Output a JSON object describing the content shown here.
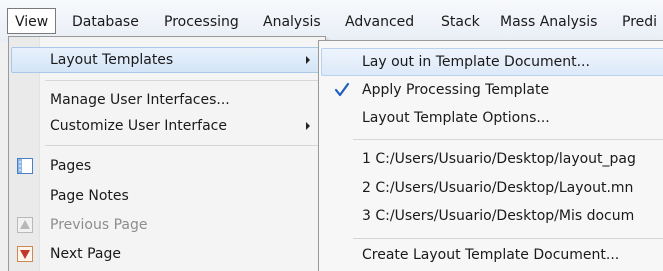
{
  "menubar": {
    "items": [
      "View",
      "Database",
      "Processing",
      "Analysis",
      "Advanced",
      "Stack",
      "Mass Analysis",
      "Predi"
    ]
  },
  "view_menu": {
    "items": [
      {
        "label": "Layout Templates",
        "icon": "",
        "submenu": true,
        "state": "highlighted"
      },
      {
        "label": "Manage User Interfaces...",
        "icon": "",
        "submenu": false,
        "state": "normal"
      },
      {
        "label": "Customize User Interface",
        "icon": "",
        "submenu": true,
        "state": "normal"
      },
      {
        "label": "Pages",
        "icon": "pages-icon",
        "submenu": false,
        "state": "normal"
      },
      {
        "label": "Page Notes",
        "icon": "",
        "submenu": false,
        "state": "normal"
      },
      {
        "label": "Previous Page",
        "icon": "previous-page-icon",
        "submenu": false,
        "state": "disabled"
      },
      {
        "label": "Next Page",
        "icon": "next-page-icon",
        "submenu": false,
        "state": "normal"
      }
    ]
  },
  "layout_submenu": {
    "items": [
      {
        "label": "Lay out in Template Document...",
        "checked": false,
        "state": "highlighted"
      },
      {
        "label": "Apply Processing Template",
        "checked": true,
        "state": "normal"
      },
      {
        "label": "Layout Template Options...",
        "checked": false,
        "state": "normal"
      },
      {
        "label": "1 C:/Users/Usuario/Desktop/layout_pag",
        "checked": false,
        "state": "normal"
      },
      {
        "label": "2 C:/Users/Usuario/Desktop/Layout.mn",
        "checked": false,
        "state": "normal"
      },
      {
        "label": "3 C:/Users/Usuario/Desktop/Mis docum",
        "checked": false,
        "state": "normal"
      },
      {
        "label": "Create Layout Template Document...",
        "checked": false,
        "state": "normal"
      }
    ]
  },
  "colors": {
    "highlight": "#d4e5f8",
    "highlight_border": "#a9c8ec",
    "menu_bg": "#f4f4f4",
    "disabled_text": "#8d8d8d",
    "check_mark": "#1f5fbf"
  }
}
